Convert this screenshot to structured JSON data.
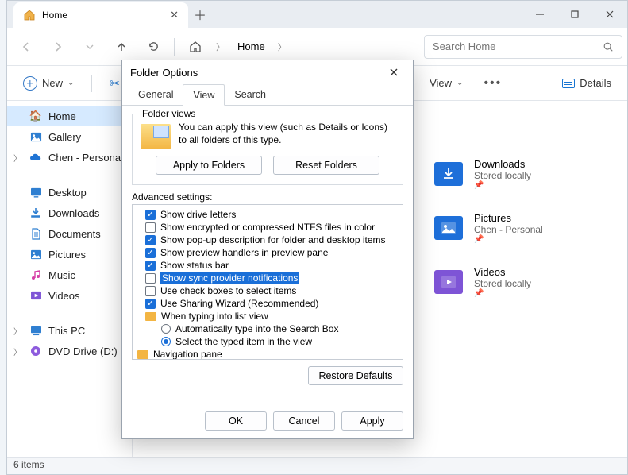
{
  "titlebar": {
    "tab_label": "Home"
  },
  "nav": {
    "crumb": "Home"
  },
  "search": {
    "placeholder": "Search Home"
  },
  "ribbon": {
    "new": "New",
    "view": "View",
    "details": "Details"
  },
  "sidebar": {
    "items": [
      {
        "label": "Home"
      },
      {
        "label": "Gallery"
      },
      {
        "label": "Chen - Persona"
      },
      {
        "label": "Desktop"
      },
      {
        "label": "Downloads"
      },
      {
        "label": "Documents"
      },
      {
        "label": "Pictures"
      },
      {
        "label": "Music"
      },
      {
        "label": "Videos"
      },
      {
        "label": "This PC"
      },
      {
        "label": "DVD Drive (D:)"
      }
    ]
  },
  "content": {
    "tiles": [
      {
        "title": "Downloads",
        "sub": "Stored locally"
      },
      {
        "title": "Pictures",
        "sub": "Chen - Personal"
      },
      {
        "title": "Videos",
        "sub": "Stored locally"
      }
    ]
  },
  "status": {
    "text": "6 items"
  },
  "dialog": {
    "title": "Folder Options",
    "tabs": {
      "general": "General",
      "view": "View",
      "search": "Search"
    },
    "folder_views": {
      "legend": "Folder views",
      "desc": "You can apply this view (such as Details or Icons) to all folders of this type.",
      "apply": "Apply to Folders",
      "reset": "Reset Folders"
    },
    "advanced_label": "Advanced settings:",
    "advanced": [
      {
        "label": "Show drive letters",
        "checked": true
      },
      {
        "label": "Show encrypted or compressed NTFS files in color",
        "checked": false
      },
      {
        "label": "Show pop-up description for folder and desktop items",
        "checked": true
      },
      {
        "label": "Show preview handlers in preview pane",
        "checked": true
      },
      {
        "label": "Show status bar",
        "checked": true
      },
      {
        "label": "Show sync provider notifications",
        "checked": false,
        "selected": true
      },
      {
        "label": "Use check boxes to select items",
        "checked": false
      },
      {
        "label": "Use Sharing Wizard (Recommended)",
        "checked": true
      },
      {
        "label": "When typing into list view",
        "group": true
      },
      {
        "label": "Automatically type into the Search Box",
        "radio": true,
        "checked": false
      },
      {
        "label": "Select the typed item in the view",
        "radio": true,
        "checked": true
      },
      {
        "label": "Navigation pane",
        "group": true
      }
    ],
    "restore": "Restore Defaults",
    "ok": "OK",
    "cancel": "Cancel",
    "apply": "Apply"
  }
}
